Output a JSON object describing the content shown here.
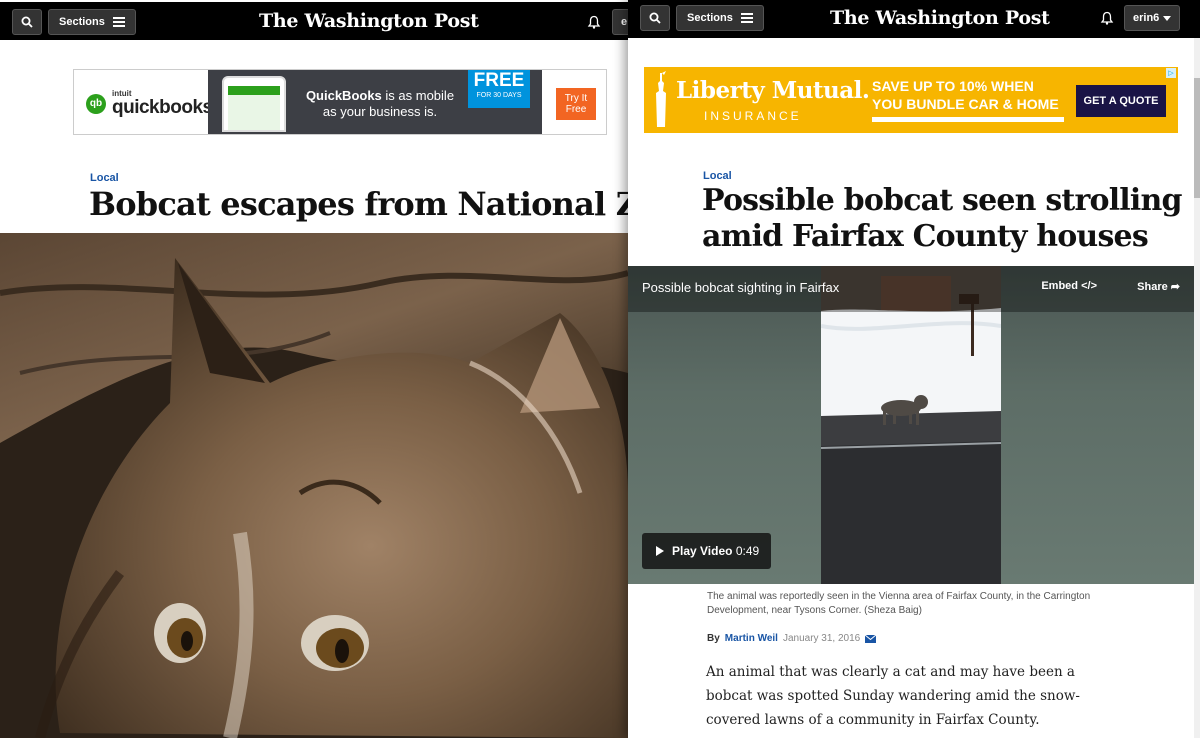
{
  "left": {
    "header": {
      "sections_label": "Sections",
      "masthead": "The Washington Post",
      "user_label": "e"
    },
    "ad": {
      "brand_prefix": "intuit",
      "brand": "quickbooks.",
      "tagline_bold": "QuickBooks",
      "tagline_rest": " is as mobile as your business is.",
      "free_big": "FREE",
      "free_small": "FOR 30 DAYS",
      "cta": "Try It Free"
    },
    "article": {
      "kicker": "Local",
      "headline": "Bobcat escapes from National Zoo"
    }
  },
  "right": {
    "header": {
      "sections_label": "Sections",
      "masthead": "The Washington Post",
      "user_label": "erin6"
    },
    "ad": {
      "brand": "Liberty Mutual.",
      "sub": "INSURANCE",
      "offer_line1": "SAVE UP TO 10% WHEN",
      "offer_line2": "YOU BUNDLE CAR & HOME",
      "cta": "GET A QUOTE"
    },
    "article": {
      "kicker": "Local",
      "headline_line1": "Possible bobcat seen strolling",
      "headline_line2": "amid Fairfax County houses",
      "video": {
        "title": "Possible bobcat sighting in Fairfax",
        "embed_label": "Embed",
        "share_label": "Share",
        "play_label": "Play Video",
        "duration": "0:49"
      },
      "caption": "The animal was reportedly seen in the Vienna area of Fairfax County, in the Carrington Development, near Tysons Corner. (Sheza Baig)",
      "byline_prefix": "By",
      "author": "Martin Weil",
      "date": "January 31, 2016",
      "body": "An animal that was clearly a cat and may have been a bobcat was spotted Sunday wandering amid the snow-covered lawns of a community in Fairfax County."
    }
  },
  "colors": {
    "kicker": "#1955a5",
    "liberty_yellow": "#f7b500",
    "liberty_navy": "#1a1446",
    "quickbooks_green": "#2ca01c",
    "free_blue": "#0093dd",
    "try_orange": "#f26522"
  },
  "icons": [
    "search-icon",
    "hamburger-icon",
    "bell-icon",
    "caret-down-icon",
    "embed-icon",
    "share-icon",
    "play-icon",
    "email-icon",
    "adchoices-icon"
  ]
}
